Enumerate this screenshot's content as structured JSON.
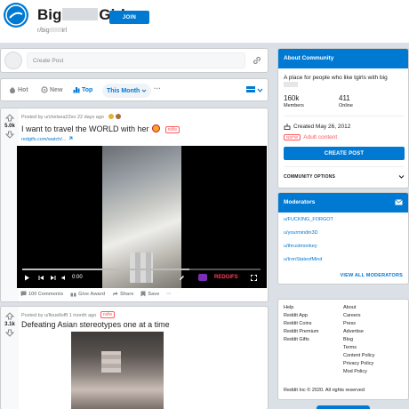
{
  "subreddit": {
    "name_start": "Big",
    "name_end": "Girl",
    "slug_start": "r/big",
    "slug_end": "irl",
    "join_label": "JOIN"
  },
  "create_post": {
    "placeholder": "Create Post"
  },
  "sort": {
    "hot": "Hot",
    "new": "New",
    "top": "Top",
    "range": "This Month",
    "more": "···"
  },
  "posts": [
    {
      "score": "5.0k",
      "meta": "Posted by u/chelsea22xo 22 days ago",
      "title": "I want to travel the WORLD with her",
      "nsfw": "nsfw",
      "link": "redgifs.com/watch/...",
      "video_time": "0:00",
      "provider": "REDGIFS",
      "actions": {
        "comments": "100 Comments",
        "award": "Give Award",
        "share": "Share",
        "save": "Save",
        "more": "···"
      }
    },
    {
      "score": "3.1k",
      "meta": "Posted by u/llouellofft 1 month ago",
      "title": "Defeating Asian stereotypes one at a time",
      "nsfw": "nsfw"
    }
  ],
  "about": {
    "header": "About Community",
    "desc_start": "A place for people who like tgirls with big",
    "members": "160k",
    "members_label": "Members",
    "online": "411",
    "online_label": "Online",
    "created": "Created May 26, 2012",
    "nsfw_tag": "NSFW",
    "adult": "Adult content",
    "create_post": "CREATE POST",
    "community_options": "COMMUNITY OPTIONS"
  },
  "moderators": {
    "header": "Moderators",
    "list": [
      "u/FUCKING_FORGOT",
      "u/yourmindin3D",
      "u/thrustmonkey",
      "u/IronStateofMind"
    ],
    "view_all": "VIEW ALL MODERATORS"
  },
  "footer": {
    "left": [
      "Help",
      "Reddit App",
      "Reddit Coins",
      "Reddit Premium",
      "Reddit Gifts"
    ],
    "right": [
      "About",
      "Careers",
      "Press",
      "Advertise",
      "Blog",
      "Terms",
      "Content Policy",
      "Privacy Policy",
      "Mod Policy"
    ],
    "copyright": "Reddit Inc © 2020. All rights reserved"
  },
  "colors": {
    "accent": "#0079d3",
    "nsfw": "#ff585b",
    "background": "#dae0e6"
  }
}
